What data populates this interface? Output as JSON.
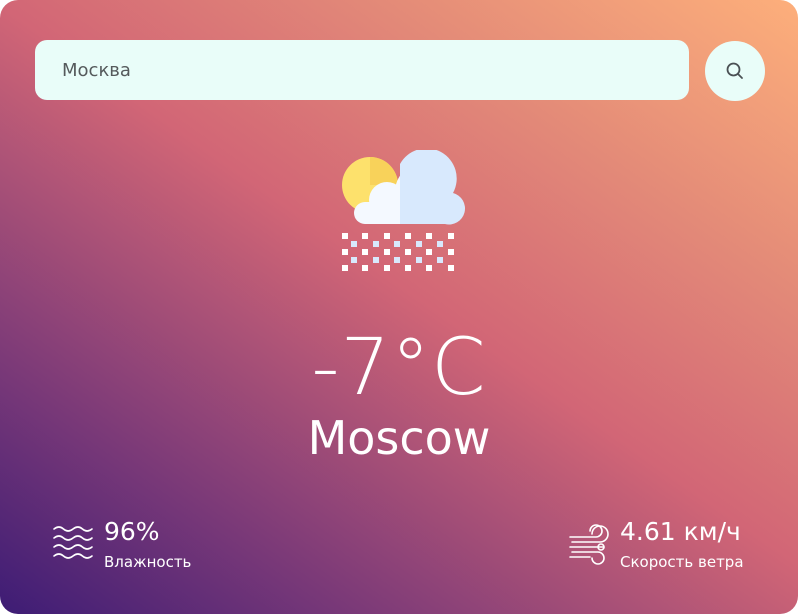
{
  "search": {
    "value": "Москва",
    "icon": "search-icon"
  },
  "weather": {
    "icon": "snow-cloud-sun-icon",
    "temperature": "-7°C",
    "city": "Moscow"
  },
  "humidity": {
    "icon": "waves-icon",
    "value": "96%",
    "label": "Влажность"
  },
  "wind": {
    "icon": "wind-icon",
    "value": "4.61 км/ч",
    "label": "Скорость ветра"
  },
  "colors": {
    "gradient_start": "#3d1c75",
    "gradient_mid": "#d26676",
    "gradient_end": "#fdaf7b",
    "input_bg": "#e9fdf9",
    "sun": "#fde16c",
    "cloud": "#eaf5fd"
  }
}
